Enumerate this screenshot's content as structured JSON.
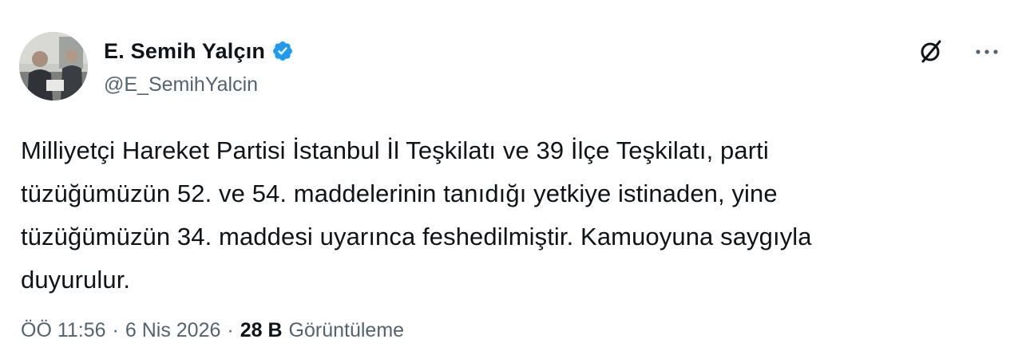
{
  "tweet": {
    "author": {
      "display_name": "E. Semih Yalçın",
      "handle": "@E_SemihYalcin",
      "verified": true,
      "avatar_icon": "profile-photo"
    },
    "actions": {
      "grok_icon": "grok-icon",
      "more_icon": "more-icon"
    },
    "text": "Milliyetçi Hareket Partisi İstanbul İl Teşkilatı ve 39 İlçe Teşkilatı, parti\ntüzüğümüzün 52. ve 54. maddelerinin tanıdığı yetkiye istinaden, yine\ntüzüğümüzün 34. maddesi uyarınca feshedilmiştir. Kamuoyuna saygıyla\nduyurulur.",
    "meta": {
      "time": "ÖÖ 11:56",
      "date": "6 Nis 2026",
      "separator": "·",
      "views_count": "28 B",
      "views_label": "Görüntüleme"
    },
    "colors": {
      "text": "#0f1419",
      "secondary": "#536471",
      "verified_blue": "#1d9bf0"
    }
  }
}
